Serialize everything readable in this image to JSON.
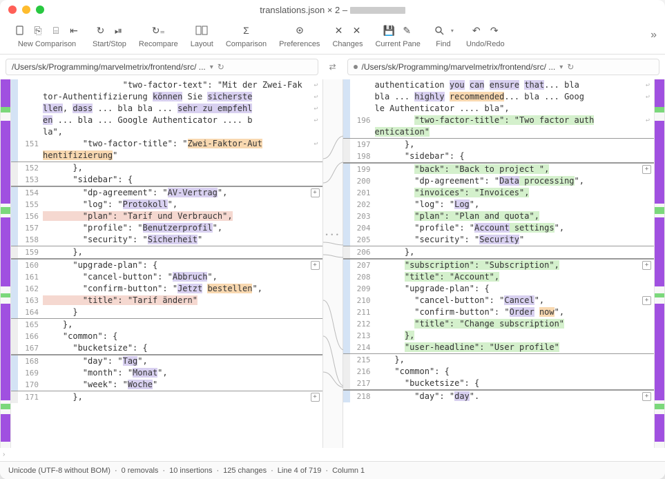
{
  "window": {
    "title_prefix": "translations.json × 2 – "
  },
  "toolbar": {
    "groups": [
      {
        "label": "New Comparison",
        "icons": [
          "doc",
          "doc2",
          "folder",
          "import"
        ]
      },
      {
        "label": "Start/Stop",
        "icons": [
          "reload",
          "pause"
        ]
      },
      {
        "label": "Recompare",
        "icons": [
          "recompare"
        ]
      },
      {
        "label": "Layout",
        "icons": [
          "layout"
        ]
      },
      {
        "label": "Comparison",
        "icons": [
          "sigma"
        ]
      },
      {
        "label": "Preferences",
        "icons": [
          "gear"
        ]
      },
      {
        "label": "Changes",
        "icons": [
          "xleft",
          "xright"
        ]
      },
      {
        "label": "Current Pane",
        "icons": [
          "save",
          "edit"
        ]
      },
      {
        "label": "Find",
        "icons": [
          "search"
        ]
      },
      {
        "label": "Undo/Redo",
        "icons": [
          "undo",
          "redo"
        ]
      }
    ]
  },
  "paths": {
    "left": "/Users/sk/Programming/marvelmetrix/frontend/src/ ...",
    "right": "/Users/sk/Programming/marvelmetrix/frontend/src/ ..."
  },
  "left_lines": [
    {
      "ln": "",
      "frag": [
        {
          "t": "                \"two-factor-text\": \"Mit der Zwei-Fak"
        }
      ],
      "arrow": true,
      "edge": "blue"
    },
    {
      "ln": "",
      "frag": [
        {
          "t": "tor-Authentifizierung "
        },
        {
          "t": "können",
          "c": "hl-pu"
        },
        {
          "t": " Sie "
        },
        {
          "t": "sicherste",
          "c": "hl-pu"
        }
      ],
      "arrow": true,
      "edge": "blue"
    },
    {
      "ln": "",
      "frag": [
        {
          "t": "llen",
          "c": "hl-pu"
        },
        {
          "t": ", "
        },
        {
          "t": "dass",
          "c": "hl-pu"
        },
        {
          "t": " ... bla bla ... "
        },
        {
          "t": "sehr zu empfehl",
          "c": "hl-pu"
        }
      ],
      "arrow": true,
      "edge": "blue"
    },
    {
      "ln": "",
      "frag": [
        {
          "t": "en",
          "c": "hl-pu"
        },
        {
          "t": " ... bla ... Google Authenticator .... b"
        }
      ],
      "arrow": true,
      "edge": "blue"
    },
    {
      "ln": "",
      "frag": [
        {
          "t": "la\","
        }
      ],
      "edge": "blue"
    },
    {
      "ln": "151",
      "frag": [
        {
          "t": "        \"two-factor-title\": \""
        },
        {
          "t": "Zwei-Faktor-Aut",
          "c": "hl-or"
        }
      ],
      "arrow": true,
      "edge": "blue"
    },
    {
      "ln": "",
      "frag": [
        {
          "t": "hentifizierung",
          "c": "hl-or"
        },
        {
          "t": "\""
        }
      ],
      "edge": "blue",
      "bb": true
    },
    {
      "ln": "152",
      "frag": [
        {
          "t": "      },"
        }
      ],
      "edge": "gray"
    },
    {
      "ln": "153",
      "frag": [
        {
          "t": "      \"sidebar\": {"
        }
      ],
      "edge": "gray",
      "bb": true
    },
    {
      "ln": "154",
      "frag": [
        {
          "t": "        \"dp-agreement\": \""
        },
        {
          "t": "AV-Vertrag",
          "c": "hl-pu"
        },
        {
          "t": "\","
        }
      ],
      "edge": "blue",
      "marker": "+",
      "bt": true
    },
    {
      "ln": "155",
      "frag": [
        {
          "t": "        \"log\": \""
        },
        {
          "t": "Protokoll",
          "c": "hl-pu"
        },
        {
          "t": "\","
        }
      ],
      "edge": "blue"
    },
    {
      "ln": "156",
      "frag": [
        {
          "t": "        ",
          "c": "hl-pk"
        },
        {
          "t": "\"plan\": \"Tarif und Verbrauch\"",
          "c": "hl-pk"
        },
        {
          "t": ",",
          "c": "hl-pk"
        }
      ],
      "edge": "blue"
    },
    {
      "ln": "157",
      "frag": [
        {
          "t": "        \"profile\": \""
        },
        {
          "t": "Benutzerprofil",
          "c": "hl-pu"
        },
        {
          "t": "\","
        }
      ],
      "edge": "blue"
    },
    {
      "ln": "158",
      "frag": [
        {
          "t": "        \"security\": \""
        },
        {
          "t": "Sicherheit",
          "c": "hl-pu"
        },
        {
          "t": "\""
        }
      ],
      "edge": "blue",
      "bb": true
    },
    {
      "ln": "159",
      "frag": [
        {
          "t": "      },"
        }
      ],
      "edge": "gray",
      "bb": true
    },
    {
      "ln": "160",
      "frag": [
        {
          "t": "      \"upgrade-plan\": {"
        }
      ],
      "edge": "blue",
      "marker": "+",
      "bt": true
    },
    {
      "ln": "161",
      "frag": [
        {
          "t": "        \"cancel-button\": \""
        },
        {
          "t": "Abbruch",
          "c": "hl-pu"
        },
        {
          "t": "\","
        }
      ],
      "edge": "blue"
    },
    {
      "ln": "162",
      "frag": [
        {
          "t": "        \"confirm-button\": \""
        },
        {
          "t": "Jetzt",
          "c": "hl-pu"
        },
        {
          "t": " "
        },
        {
          "t": "bestellen",
          "c": "hl-or"
        },
        {
          "t": "\","
        }
      ],
      "edge": "blue"
    },
    {
      "ln": "163",
      "frag": [
        {
          "t": "        ",
          "c": "hl-pk"
        },
        {
          "t": "\"title\": \"Tarif ändern\"",
          "c": "hl-pk"
        }
      ],
      "edge": "blue"
    },
    {
      "ln": "164",
      "frag": [
        {
          "t": "      }"
        }
      ],
      "edge": "blue",
      "bb": true
    },
    {
      "ln": "165",
      "frag": [
        {
          "t": "    },"
        }
      ],
      "edge": "gray"
    },
    {
      "ln": "166",
      "frag": [
        {
          "t": "    \"common\": {"
        }
      ],
      "edge": "gray"
    },
    {
      "ln": "167",
      "frag": [
        {
          "t": "      \"bucketsize\": {"
        }
      ],
      "edge": "gray",
      "bb": true
    },
    {
      "ln": "168",
      "frag": [
        {
          "t": "        \"day\": \""
        },
        {
          "t": "Tag",
          "c": "hl-pu"
        },
        {
          "t": "\","
        }
      ],
      "edge": "blue",
      "bt": true
    },
    {
      "ln": "169",
      "frag": [
        {
          "t": "        \"month\": \""
        },
        {
          "t": "Monat",
          "c": "hl-pu"
        },
        {
          "t": "\","
        }
      ],
      "edge": "blue"
    },
    {
      "ln": "170",
      "frag": [
        {
          "t": "        \"week\": \""
        },
        {
          "t": "Woche",
          "c": "hl-pu"
        },
        {
          "t": "\""
        }
      ],
      "edge": "blue",
      "bb": true
    },
    {
      "ln": "171",
      "frag": [
        {
          "t": "      },"
        }
      ],
      "edge": "gray",
      "marker": "+"
    }
  ],
  "right_lines": [
    {
      "ln": "",
      "frag": [
        {
          "t": "authentication "
        },
        {
          "t": "you",
          "c": "hl-pu"
        },
        {
          "t": " "
        },
        {
          "t": "can",
          "c": "hl-pu"
        },
        {
          "t": " "
        },
        {
          "t": "ensure",
          "c": "hl-pu"
        },
        {
          "t": " "
        },
        {
          "t": "that",
          "c": "hl-pu"
        },
        {
          "t": "... bla"
        }
      ],
      "arrow": true,
      "edge": "blue"
    },
    {
      "ln": "",
      "frag": [
        {
          "t": "bla ... "
        },
        {
          "t": "highly",
          "c": "hl-pu"
        },
        {
          "t": " "
        },
        {
          "t": "recommended",
          "c": "hl-or"
        },
        {
          "t": "... bla ... Goog"
        }
      ],
      "arrow": true,
      "edge": "blue"
    },
    {
      "ln": "",
      "frag": [
        {
          "t": "le Authenticator .... bla\","
        }
      ],
      "edge": "blue"
    },
    {
      "ln": "196",
      "frag": [
        {
          "t": "        "
        },
        {
          "t": "\"two-factor-title\": \"Two factor auth",
          "c": "hl-gn"
        }
      ],
      "arrow": true,
      "edge": "blue"
    },
    {
      "ln": "",
      "frag": [
        {
          "t": "entication\"",
          "c": "hl-gn"
        }
      ],
      "edge": "blue",
      "bb": true
    },
    {
      "ln": "197",
      "frag": [
        {
          "t": "      },"
        }
      ],
      "edge": "gray"
    },
    {
      "ln": "198",
      "frag": [
        {
          "t": "      \"sidebar\": {"
        }
      ],
      "edge": "gray",
      "bb": true
    },
    {
      "ln": "199",
      "frag": [
        {
          "t": "        "
        },
        {
          "t": "\"back\": \"Back to project \",",
          "c": "hl-gn"
        }
      ],
      "edge": "blue",
      "marker": "+",
      "bt": true
    },
    {
      "ln": "200",
      "frag": [
        {
          "t": "        \"dp-agreement\": \""
        },
        {
          "t": "Data",
          "c": "hl-pu"
        },
        {
          "t": " ",
          "c": "hl-gn"
        },
        {
          "t": "processing",
          "c": "hl-gn"
        },
        {
          "t": "\","
        }
      ],
      "edge": "blue"
    },
    {
      "ln": "201",
      "frag": [
        {
          "t": "        "
        },
        {
          "t": "\"invoices\": \"Invoices\",",
          "c": "hl-gn"
        }
      ],
      "edge": "blue"
    },
    {
      "ln": "202",
      "frag": [
        {
          "t": "        \"log\": \""
        },
        {
          "t": "Log",
          "c": "hl-pu"
        },
        {
          "t": "\","
        }
      ],
      "edge": "blue"
    },
    {
      "ln": "203",
      "frag": [
        {
          "t": "        "
        },
        {
          "t": "\"plan\": \"Plan and quota\",",
          "c": "hl-gn"
        }
      ],
      "edge": "blue"
    },
    {
      "ln": "204",
      "frag": [
        {
          "t": "        \"profile\": \""
        },
        {
          "t": "Account",
          "c": "hl-pu"
        },
        {
          "t": " ",
          "c": "hl-gn"
        },
        {
          "t": "settings",
          "c": "hl-gn"
        },
        {
          "t": "\","
        }
      ],
      "edge": "blue"
    },
    {
      "ln": "205",
      "frag": [
        {
          "t": "        \"security\": \""
        },
        {
          "t": "Security",
          "c": "hl-pu"
        },
        {
          "t": "\""
        }
      ],
      "edge": "blue",
      "bb": true
    },
    {
      "ln": "206",
      "frag": [
        {
          "t": "      },"
        }
      ],
      "edge": "gray",
      "bb": true
    },
    {
      "ln": "207",
      "frag": [
        {
          "t": "      "
        },
        {
          "t": "\"subscription\": \"Subscription\",",
          "c": "hl-gn"
        }
      ],
      "edge": "blue",
      "marker": "+",
      "bt": true
    },
    {
      "ln": "208",
      "frag": [
        {
          "t": "      "
        },
        {
          "t": "\"title\": \"Account\",",
          "c": "hl-gn"
        }
      ],
      "edge": "blue"
    },
    {
      "ln": "209",
      "frag": [
        {
          "t": "      \"upgrade-plan\": {"
        }
      ],
      "edge": "blue"
    },
    {
      "ln": "210",
      "frag": [
        {
          "t": "        \"cancel-button\": \""
        },
        {
          "t": "Cancel",
          "c": "hl-pu"
        },
        {
          "t": "\","
        }
      ],
      "edge": "blue",
      "marker": "+"
    },
    {
      "ln": "211",
      "frag": [
        {
          "t": "        \"confirm-button\": \""
        },
        {
          "t": "Order",
          "c": "hl-pu"
        },
        {
          "t": " "
        },
        {
          "t": "now",
          "c": "hl-or"
        },
        {
          "t": "\","
        }
      ],
      "edge": "blue"
    },
    {
      "ln": "212",
      "frag": [
        {
          "t": "        "
        },
        {
          "t": "\"title\": \"Change subscription\"",
          "c": "hl-gn"
        }
      ],
      "edge": "blue"
    },
    {
      "ln": "213",
      "frag": [
        {
          "t": "      "
        },
        {
          "t": "},",
          "c": "hl-gn"
        }
      ],
      "edge": "blue"
    },
    {
      "ln": "214",
      "frag": [
        {
          "t": "      "
        },
        {
          "t": "\"user-headline\": \"User profile\"",
          "c": "hl-gn"
        }
      ],
      "edge": "blue",
      "bb": true
    },
    {
      "ln": "215",
      "frag": [
        {
          "t": "    },"
        }
      ],
      "edge": "gray"
    },
    {
      "ln": "216",
      "frag": [
        {
          "t": "    \"common\": {"
        }
      ],
      "edge": "gray"
    },
    {
      "ln": "217",
      "frag": [
        {
          "t": "      \"bucketsize\": {"
        }
      ],
      "edge": "gray",
      "bb": true
    },
    {
      "ln": "218",
      "frag": [
        {
          "t": "        \"day\": \""
        },
        {
          "t": "day",
          "c": "hl-pu"
        },
        {
          "t": "\"."
        }
      ],
      "edge": "blue",
      "marker": "+",
      "bt": true
    }
  ],
  "status": {
    "encoding": "Unicode (UTF-8 without BOM)",
    "removals": "0 removals",
    "insertions": "10 insertions",
    "changes": "125 changes",
    "line": "Line 4 of 719",
    "column": "Column 1"
  },
  "mid_dots": "• • •"
}
